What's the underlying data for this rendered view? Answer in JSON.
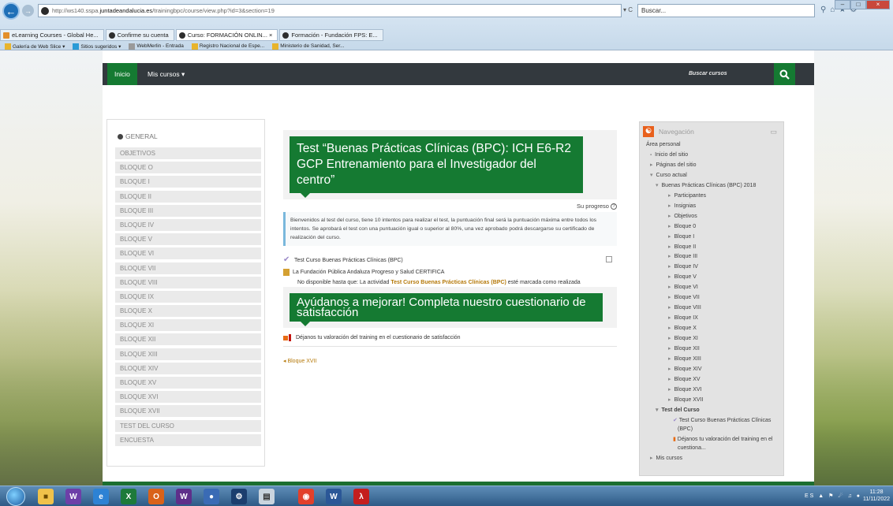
{
  "browser": {
    "url_prefix": "http://ws140.sspa.",
    "url_domain": "juntadeandalucia.es",
    "url_rest": "/trainingbpc/course/view.php?id=3&section=19",
    "addr_controls": "▾ C",
    "search_placeholder": "Buscar...",
    "tabs": [
      {
        "label": "eLearning Courses - Global He..."
      },
      {
        "label": "Confirme su cuenta"
      },
      {
        "label": "Curso: FORMACIÓN ONLIN... ×"
      },
      {
        "label": "Formación - Fundación FPS: E..."
      }
    ],
    "favorites": [
      {
        "label": "Galería de Web Slice ▾"
      },
      {
        "label": "Sitios sugeridos ▾"
      },
      {
        "label": "WebMerlin - Entrada"
      },
      {
        "label": "Registro Nacional de Espe..."
      },
      {
        "label": "Ministerio de Sanidad, Ser..."
      }
    ]
  },
  "topbar": {
    "home": "Inicio",
    "my_courses": "Mis cursos ▾",
    "search": "Buscar cursos"
  },
  "sections": {
    "general": "GENERAL",
    "items": [
      {
        "label": "OBJETIVOS"
      },
      {
        "label": "BLOQUE o"
      },
      {
        "label": "BLOQUE I"
      },
      {
        "label": "BLOQUE II"
      },
      {
        "label": "BLOQUE III"
      },
      {
        "label": "BLOQUE IV"
      },
      {
        "label": "BLOQUE V"
      },
      {
        "label": "BLOQUE VI"
      },
      {
        "label": "BLOQUE VII"
      },
      {
        "label": "BLOQUE VIII"
      },
      {
        "label": "BLOQUE IX"
      },
      {
        "label": "BLOQUE X"
      },
      {
        "label": "BLOQUE XI"
      },
      {
        "label": "BLOQUE XII"
      },
      {
        "label": "BLOQUE XIII"
      },
      {
        "label": "BLOQUE XIV"
      },
      {
        "label": "BLOQUE XV"
      },
      {
        "label": "BLOQUE XVI"
      },
      {
        "label": "BLOQUE XVII"
      },
      {
        "label": "TEST DEL CURSO"
      },
      {
        "label": "ENCUESTA"
      }
    ]
  },
  "main": {
    "title": "Test “Buenas Prácticas Clínicas (BPC): ICH E6-R2 GCP Entrenamiento para el Investigador del centro”",
    "progress_label": "Su progreso",
    "intro": "Bienvenidos al test del curso, tiene 10 intentos para realizar el test, la puntuación final será la puntuación máxima entre todos los intentos. Se aprobará el test con una puntuación igual o superior al 80%, una vez aprobado podrá descargarse su certificado de realización del curso.",
    "activity_quiz": "Test Curso Buenas Prácticas Clínicas (BPC)",
    "activity_cert": "La Fundación Pública Andaluza Progreso y Salud CERTIFICA",
    "restriction_prefix": "No disponible hasta que: La actividad",
    "restriction_link": "Test Curso Buenas Prácticas Clínicas (BPC)",
    "restriction_suffix": "esté marcada como realizada",
    "survey_title": "Ayúdanos a mejorar! Completa nuestro cuestionario de satisfacción",
    "feedback": "Déjanos tu valoración del training en el cuestionario de satisfacción",
    "prev_section": "◂ Bloque XVII"
  },
  "navigation": {
    "title": "Navegación",
    "collapse": "▭",
    "items": [
      {
        "label": "Área personal",
        "level": "n0",
        "kind": ""
      },
      {
        "label": "Inicio del sitio",
        "level": "n1",
        "kind": "dot"
      },
      {
        "label": "Páginas del sitio",
        "level": "n1",
        "kind": "tri"
      },
      {
        "label": "Curso actual",
        "level": "n1",
        "kind": "open"
      },
      {
        "label": "Buenas Prácticas Clínicas (BPC) 2018",
        "level": "n2",
        "kind": "open"
      },
      {
        "label": "Participantes",
        "level": "n3",
        "kind": "tri"
      },
      {
        "label": "Insignias",
        "level": "n3",
        "kind": "tri"
      },
      {
        "label": "Objetivos",
        "level": "n3",
        "kind": "tri"
      },
      {
        "label": "Bloque 0",
        "level": "n3",
        "kind": "tri"
      },
      {
        "label": "Bloque I",
        "level": "n3",
        "kind": "tri"
      },
      {
        "label": "Bloque II",
        "level": "n3",
        "kind": "tri"
      },
      {
        "label": "Bloque III",
        "level": "n3",
        "kind": "tri"
      },
      {
        "label": "Bloque IV",
        "level": "n3",
        "kind": "tri"
      },
      {
        "label": "Bloque V",
        "level": "n3",
        "kind": "tri"
      },
      {
        "label": "Bloque VI",
        "level": "n3",
        "kind": "tri"
      },
      {
        "label": "Bloque VII",
        "level": "n3",
        "kind": "tri"
      },
      {
        "label": "Bloque VIII",
        "level": "n3",
        "kind": "tri"
      },
      {
        "label": "Bloque IX",
        "level": "n3",
        "kind": "tri"
      },
      {
        "label": "Bloque X",
        "level": "n3",
        "kind": "tri"
      },
      {
        "label": "Bloque XI",
        "level": "n3",
        "kind": "tri"
      },
      {
        "label": "Bloque XII",
        "level": "n3",
        "kind": "tri"
      },
      {
        "label": "Bloque XIII",
        "level": "n3",
        "kind": "tri"
      },
      {
        "label": "Bloque XIV",
        "level": "n3",
        "kind": "tri"
      },
      {
        "label": "Bloque XV",
        "level": "n3",
        "kind": "tri"
      },
      {
        "label": "Bloque XVI",
        "level": "n3",
        "kind": "tri"
      },
      {
        "label": "Bloque XVII",
        "level": "n3",
        "kind": "tri"
      }
    ],
    "test_section": "Test del Curso",
    "test_quiz_line1": "Test Curso Buenas Prácticas Clínicas",
    "test_quiz_line2": "(BPC)",
    "test_feedback_line1": "Déjanos tu valoración del training en el",
    "test_feedback_line2": "cuestiona...",
    "my_courses": "Mis cursos"
  },
  "taskbar": {
    "lang": "ES",
    "time": "11:28",
    "date": "11/11/2022"
  },
  "colors": {
    "brand_green": "#157a32",
    "topbar_dark": "#33393e",
    "link_orange": "#b5790a"
  }
}
